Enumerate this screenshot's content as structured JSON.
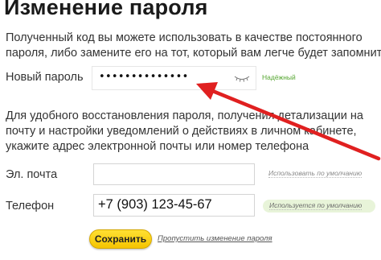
{
  "title": "Изменение пароля",
  "intro": {
    "line1": "Полученный код вы можете использовать в качестве постоянного",
    "line2": "пароля, либо замените его на тот, который вам легче будет запомнить"
  },
  "password": {
    "label": "Новый пароль",
    "value": "••••••••••••••",
    "strength": "Надёжный",
    "show_icon": "eye-toggle-icon"
  },
  "hint": {
    "line1": "Для удобного восстановления пароля, получения детализации на",
    "line2": "почту и настройки уведомлений о действиях в личном кабинете,",
    "line3": "укажите адрес электронной почты или номер телефона"
  },
  "email": {
    "label": "Эл. почта",
    "value": "",
    "status": "Использовать по умолчанию"
  },
  "phone": {
    "label": "Телефон",
    "value": "+7 (903) 123-45-67",
    "status": "Используется по умолчанию"
  },
  "actions": {
    "save_label": "Сохранить",
    "skip_label": "Пропустить изменение пароля"
  },
  "colors": {
    "accent_button": "#f5c400",
    "arrow": "#e02020",
    "strength": "#55a630"
  }
}
